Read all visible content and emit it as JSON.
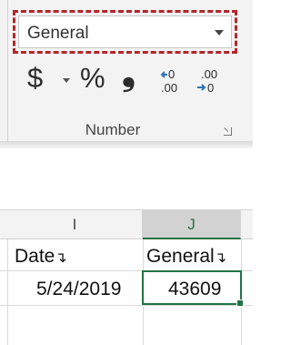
{
  "ribbon": {
    "number_format": {
      "value": "General"
    },
    "buttons": {
      "currency": "$",
      "percent": "%",
      "comma": "❟",
      "increase_decimal_top": "←0",
      "increase_decimal_bottom": ".00",
      "decrease_decimal_top": ".00",
      "decrease_decimal_bottom": "→0"
    },
    "group_label": "Number",
    "accent_color": "#b3262b"
  },
  "sheet": {
    "columns": [
      "I",
      "J"
    ],
    "headers": {
      "I": "Date",
      "J": "General"
    },
    "row": {
      "I": "5/24/2019",
      "J": "43609"
    },
    "filter_glyph": "↴",
    "selection_color": "#217346"
  }
}
